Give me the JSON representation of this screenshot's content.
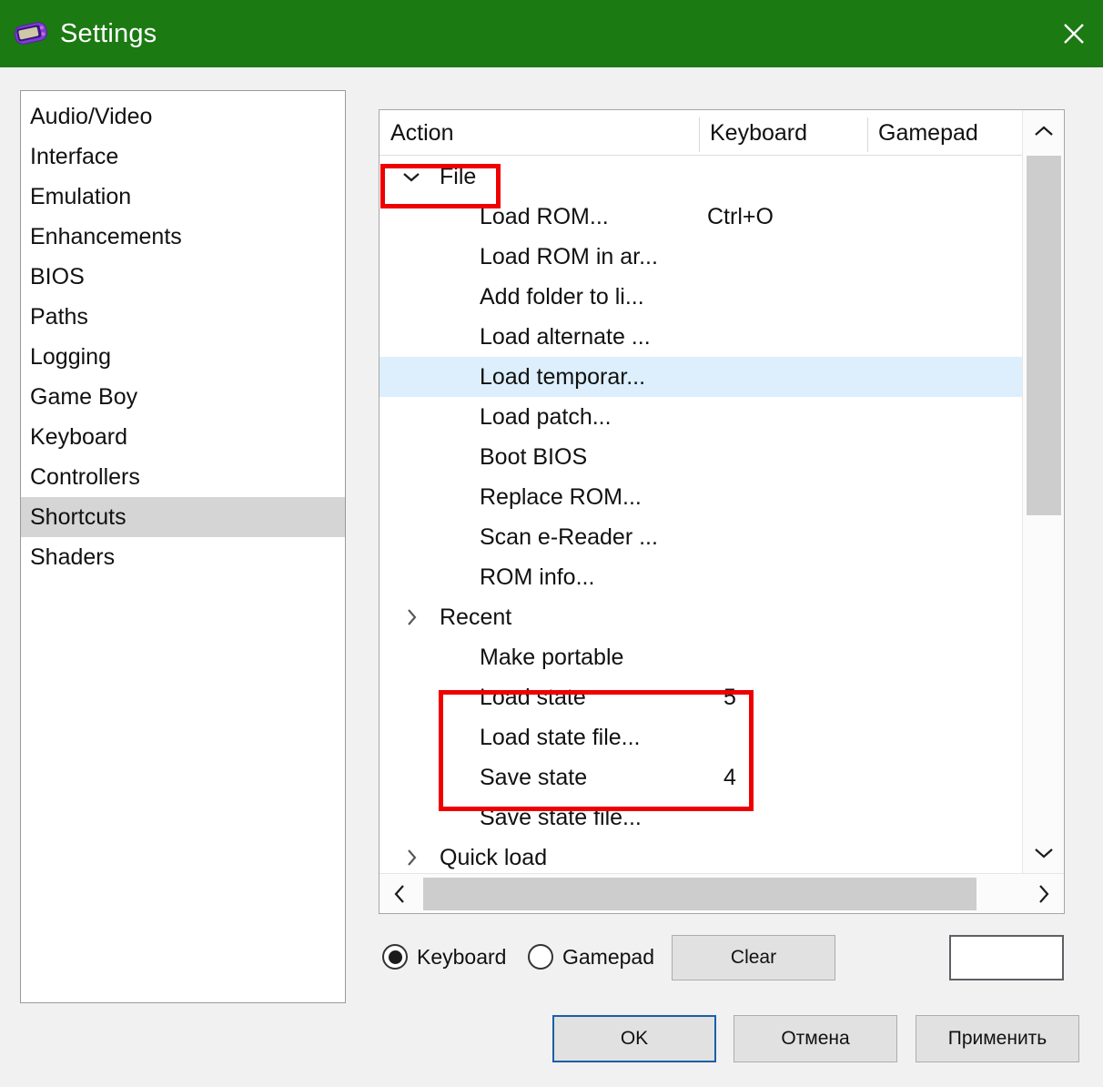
{
  "window": {
    "title": "Settings",
    "icon": "gba-console-icon",
    "close_icon": "close-icon",
    "titlebar_color": "#1b7a12"
  },
  "sidebar": {
    "selected": "Shortcuts",
    "items": [
      {
        "label": "Audio/Video"
      },
      {
        "label": "Interface"
      },
      {
        "label": "Emulation"
      },
      {
        "label": "Enhancements"
      },
      {
        "label": "BIOS"
      },
      {
        "label": "Paths"
      },
      {
        "label": "Logging"
      },
      {
        "label": "Game Boy"
      },
      {
        "label": "Keyboard"
      },
      {
        "label": "Controllers"
      },
      {
        "label": "Shortcuts"
      },
      {
        "label": "Shaders"
      }
    ]
  },
  "table": {
    "columns": [
      {
        "label": "Action"
      },
      {
        "label": "Keyboard"
      },
      {
        "label": "Gamepad"
      }
    ],
    "rows": [
      {
        "label": "File",
        "type": "group",
        "expanded": true,
        "chevron": "chevron-down-icon",
        "keyboard": ""
      },
      {
        "label": "Load ROM...",
        "type": "child",
        "keyboard": "Ctrl+O"
      },
      {
        "label": "Load ROM in ar...",
        "type": "child",
        "keyboard": ""
      },
      {
        "label": "Add folder to li...",
        "type": "child",
        "keyboard": ""
      },
      {
        "label": "Load alternate ...",
        "type": "child",
        "keyboard": ""
      },
      {
        "label": "Load temporar...",
        "type": "child",
        "keyboard": "",
        "hovered": true
      },
      {
        "label": "Load patch...",
        "type": "child",
        "keyboard": ""
      },
      {
        "label": "Boot BIOS",
        "type": "child",
        "keyboard": ""
      },
      {
        "label": "Replace ROM...",
        "type": "child",
        "keyboard": ""
      },
      {
        "label": "Scan e-Reader ...",
        "type": "child",
        "keyboard": ""
      },
      {
        "label": "ROM info...",
        "type": "child",
        "keyboard": ""
      },
      {
        "label": "Recent",
        "type": "group",
        "expanded": false,
        "chevron": "chevron-right-icon",
        "keyboard": ""
      },
      {
        "label": "Make portable",
        "type": "child",
        "keyboard": ""
      },
      {
        "label": "Load state",
        "type": "child",
        "keyboard": "5"
      },
      {
        "label": "Load state file...",
        "type": "child",
        "keyboard": ""
      },
      {
        "label": "Save state",
        "type": "child",
        "keyboard": "4"
      },
      {
        "label": "Save state file...",
        "type": "child",
        "keyboard": ""
      },
      {
        "label": "Quick load",
        "type": "group",
        "expanded": false,
        "chevron": "chevron-right-icon",
        "keyboard": ""
      }
    ],
    "vscroll": {
      "up_icon": "chevron-up-icon",
      "down_icon": "chevron-down-icon"
    },
    "hscroll": {
      "left_icon": "chevron-left-icon",
      "right_icon": "chevron-right-icon"
    }
  },
  "annotations": {
    "color": "#ef0000",
    "boxes": [
      {
        "name": "file-row-highlight"
      },
      {
        "name": "state-rows-highlight"
      }
    ]
  },
  "bottom": {
    "device_keyboard_label": "Keyboard",
    "device_gamepad_label": "Gamepad",
    "device_selected": "Keyboard",
    "clear_label": "Clear",
    "binding_value": "",
    "binding_placeholder": ""
  },
  "dialog_buttons": {
    "ok": "OK",
    "cancel": "Отмена",
    "apply": "Применить"
  }
}
